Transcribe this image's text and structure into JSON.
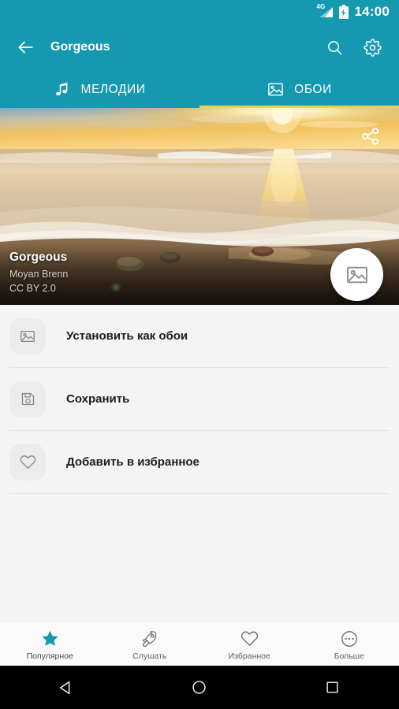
{
  "status_bar": {
    "network": "4G",
    "battery_icon": "battery-charging-icon",
    "time": "14:00"
  },
  "toolbar": {
    "back_icon": "back-arrow-icon",
    "title": "Gorgeous",
    "search_icon": "search-icon",
    "settings_icon": "gear-icon"
  },
  "tabs": [
    {
      "label": "МЕЛОДИИ",
      "icon": "music-note-icon",
      "active": false
    },
    {
      "label": "ОБОИ",
      "icon": "image-icon",
      "active": true
    }
  ],
  "tab_indicator_color": "#f2cf4f",
  "hero": {
    "share_icon": "share-icon",
    "title": "Gorgeous",
    "author": "Moyan Brenn",
    "license": "CC BY 2.0",
    "fab_icon": "image-icon",
    "description": "Sunset over a beach with waves washing over wet sand and pebbles"
  },
  "actions": [
    {
      "label": "Установить как обои",
      "icon": "image-icon"
    },
    {
      "label": "Сохранить",
      "icon": "floppy-save-icon"
    },
    {
      "label": "Добавить в избранное",
      "icon": "heart-icon"
    }
  ],
  "bottom_nav": [
    {
      "label": "Популярное",
      "icon": "star-icon",
      "active": true
    },
    {
      "label": "Слушать",
      "icon": "rocket-icon",
      "active": false
    },
    {
      "label": "Избранное",
      "icon": "heart-icon",
      "active": false
    },
    {
      "label": "Больше",
      "icon": "more-circle-icon",
      "active": false
    }
  ],
  "system_nav": [
    {
      "icon": "android-back-icon"
    },
    {
      "icon": "android-home-icon"
    },
    {
      "icon": "android-recents-icon"
    }
  ],
  "colors": {
    "primary": "#1499b0",
    "accent": "#f2cf4f",
    "background": "#f4f4f4",
    "nav_active": "#1499b0"
  }
}
